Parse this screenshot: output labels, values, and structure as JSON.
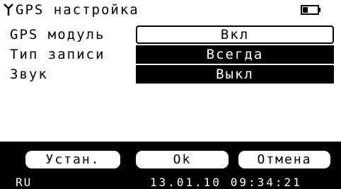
{
  "header": {
    "title": "GPS настройка",
    "icon_left": "antenna-icon",
    "icon_right": "battery-icon"
  },
  "rows": [
    {
      "label": "GPS модуль",
      "value": "Вкл",
      "selected": true
    },
    {
      "label": "Тип записи",
      "value": "Всегда",
      "selected": false
    },
    {
      "label": "Звук",
      "value": "Выкл",
      "selected": false
    }
  ],
  "buttons": {
    "set": "Устан.",
    "ok": "Ok",
    "cancel": "Отмена"
  },
  "status": {
    "language": "RU",
    "datetime": "13.01.10 09:34:21"
  },
  "colors": {
    "background": "#000000",
    "foreground": "#ffffff"
  }
}
